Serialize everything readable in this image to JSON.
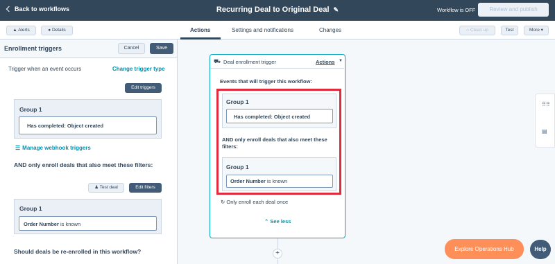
{
  "topbar": {
    "back_label": "Back to workflows",
    "title": "Recurring Deal to Original Deal",
    "status": "Workflow is OFF",
    "review_label": "Review and publish"
  },
  "subbar": {
    "alerts_label": "Alerts",
    "details_label": "Details",
    "tabs": [
      "Actions",
      "Settings and notifications",
      "Changes"
    ],
    "cleanup_label": "Clean up",
    "test_label": "Test",
    "more_label": "More"
  },
  "left_panel": {
    "title": "Enrollment triggers",
    "cancel_label": "Cancel",
    "save_label": "Save",
    "trigger_label": "Trigger when an event occurs",
    "change_link": "Change trigger type",
    "edit_triggers_label": "Edit triggers",
    "group1_title": "Group 1",
    "group1_filter": "Has completed: Object created",
    "webhook_link": "Manage webhook triggers",
    "and_text": "AND only enroll deals that also meet these filters:",
    "test_deal_label": "Test deal",
    "edit_filters_label": "Edit filters",
    "group2_title": "Group 1",
    "group2_prop": "Order Number",
    "group2_op": " is known",
    "reenroll_text": "Should deals be re-enrolled in this workflow?"
  },
  "card": {
    "title": "Deal enrollment trigger",
    "actions_label": "Actions",
    "events_label": "Events that will trigger this workflow:",
    "group1_title": "Group 1",
    "group1_filter": "Has completed: Object created",
    "and_text": "AND only enroll deals that also meet these filters:",
    "group2_title": "Group 1",
    "group2_prop": "Order Number",
    "group2_op": " is known",
    "once_text": "Only enroll each deal once",
    "see_less": "See less"
  },
  "floating": {
    "explore_label": "Explore Operations Hub",
    "help_label": "Help"
  },
  "colors": {
    "topbar": "#33475b",
    "accent_teal": "#00a4bd",
    "link": "#0091ae",
    "highlight_red": "#e02b3c",
    "explore_orange": "#ff8f59"
  }
}
